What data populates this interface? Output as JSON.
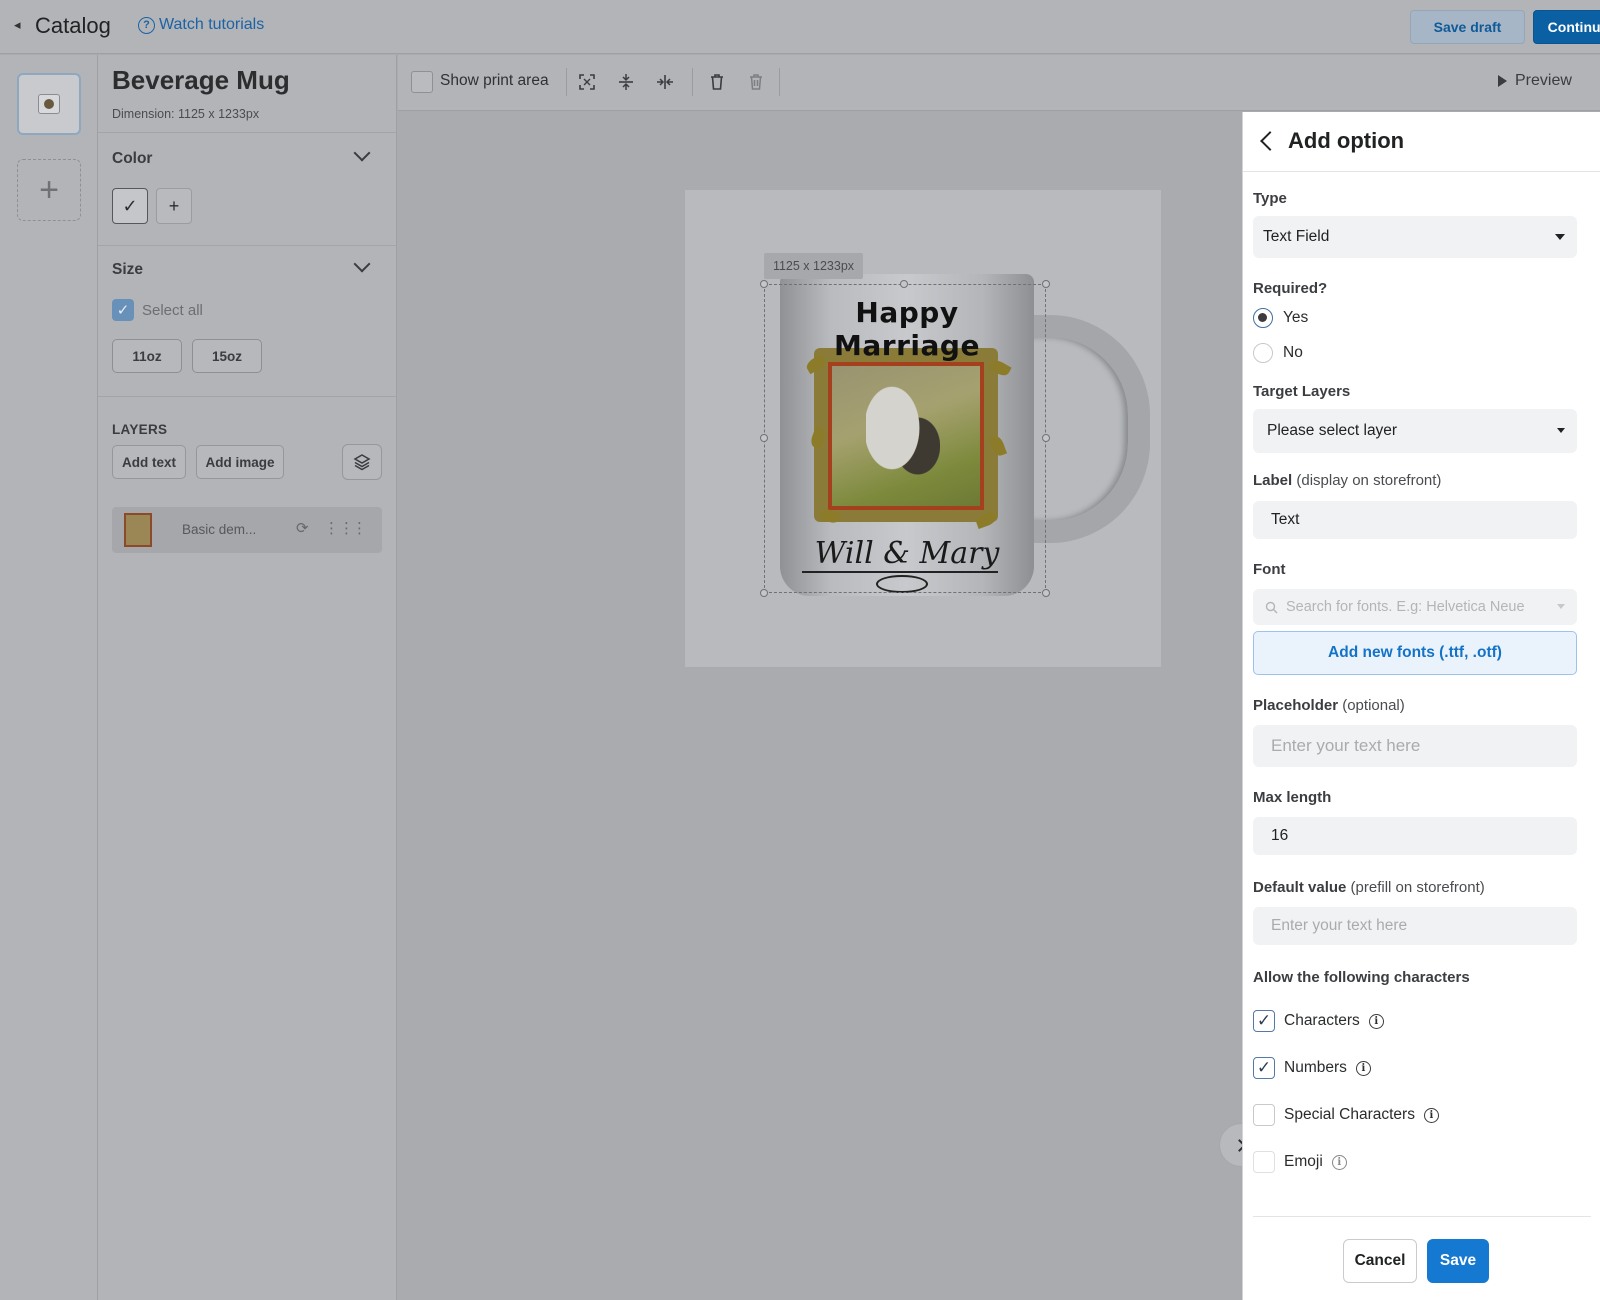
{
  "topbar": {
    "back_label": "Catalog",
    "tutorials_label": "Watch tutorials",
    "save_draft_label": "Save draft",
    "continue_label": "Continue"
  },
  "product": {
    "name": "Beverage Mug",
    "dimension": "Dimension: 1125 x 1233px"
  },
  "color_section": {
    "title": "Color"
  },
  "size_section": {
    "title": "Size",
    "select_all_label": "Select all",
    "sizes": [
      "11oz",
      "15oz"
    ]
  },
  "layers_section": {
    "title": "LAYERS",
    "add_text_label": "Add text",
    "add_image_label": "Add image",
    "items": [
      {
        "name": "Basic dem..."
      }
    ]
  },
  "toolbar": {
    "show_print_area_label": "Show print area",
    "preview_label": "Preview"
  },
  "canvas": {
    "dimension_badge": "1125 x 1233px",
    "mug_title": "Happy Marriage",
    "mug_names": "Will & Mary"
  },
  "option_panel": {
    "title": "Add option",
    "type": {
      "label": "Type",
      "value": "Text Field"
    },
    "required": {
      "label": "Required?",
      "options": [
        "Yes",
        "No"
      ],
      "selected": "Yes"
    },
    "target_layers": {
      "label": "Target Layers",
      "value": "Please select layer"
    },
    "label_field": {
      "label": "Label",
      "hint": "(display on storefront)",
      "value": "Text"
    },
    "font": {
      "label": "Font",
      "placeholder": "Search for fonts. E.g: Helvetica Neue",
      "add_fonts_label": "Add new fonts (.ttf, .otf)"
    },
    "placeholder_field": {
      "label": "Placeholder",
      "hint": "(optional)",
      "placeholder": "Enter your text here"
    },
    "max_length": {
      "label": "Max length",
      "value": "16"
    },
    "default_value": {
      "label": "Default value",
      "hint": "(prefill on storefront)",
      "placeholder": "Enter your text here"
    },
    "allowed_chars": {
      "label": "Allow the following characters",
      "options": [
        {
          "label": "Characters",
          "checked": true
        },
        {
          "label": "Numbers",
          "checked": true
        },
        {
          "label": "Special Characters",
          "checked": false
        },
        {
          "label": "Emoji",
          "checked": false
        }
      ]
    },
    "cancel_label": "Cancel",
    "save_label": "Save"
  },
  "colors": {
    "primary_blue": "#1679d1",
    "continue_blue": "#0a60a3",
    "overlay_gray": "#a9abae"
  }
}
